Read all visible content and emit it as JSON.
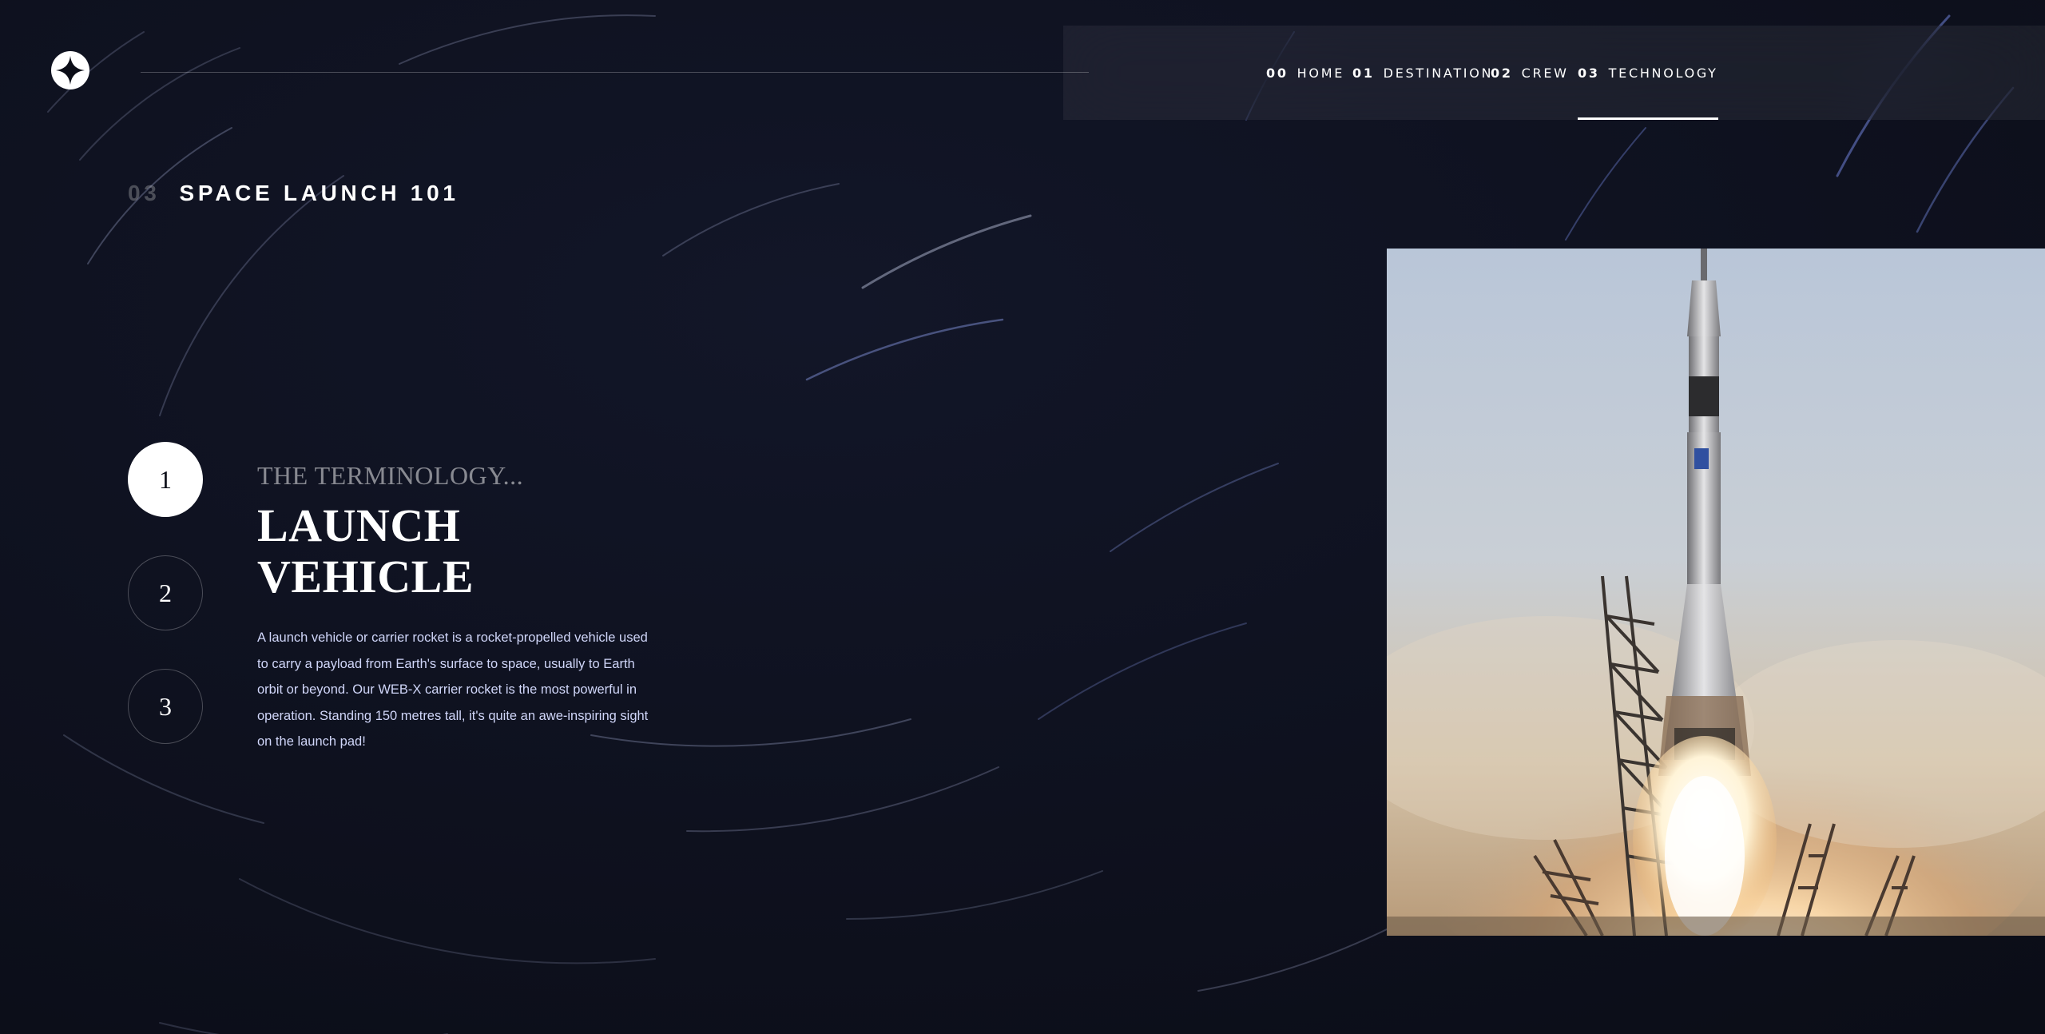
{
  "site": {
    "logo_icon": "star-logo-icon"
  },
  "nav": {
    "items": [
      {
        "num": "00",
        "label": "HOME"
      },
      {
        "num": "01",
        "label": "DESTINATION"
      },
      {
        "num": "02",
        "label": "CREW"
      },
      {
        "num": "03",
        "label": "TECHNOLOGY"
      }
    ],
    "active": "03"
  },
  "page": {
    "heading_num": "03",
    "heading": "SPACE LAUNCH 101"
  },
  "steps": [
    "1",
    "2",
    "3"
  ],
  "active_step": "1",
  "technology": {
    "subheading": "THE TERMINOLOGY...",
    "name": "LAUNCH VEHICLE",
    "description": "A launch vehicle or carrier rocket is a rocket-propelled vehicle used to carry a payload from Earth's surface to space, usually to Earth orbit or beyond. Our WEB-X carrier rocket is the most powerful in operation. Standing 150 metres tall, it's quite an awe-inspiring sight on the launch pad!"
  },
  "image": {
    "icon": "rocket-launch-image"
  },
  "colors": {
    "background": "#0b0d17",
    "text": "#ffffff",
    "muted": "#d0d6f9",
    "nav_bg": "rgba(255,255,255,0.06)"
  }
}
